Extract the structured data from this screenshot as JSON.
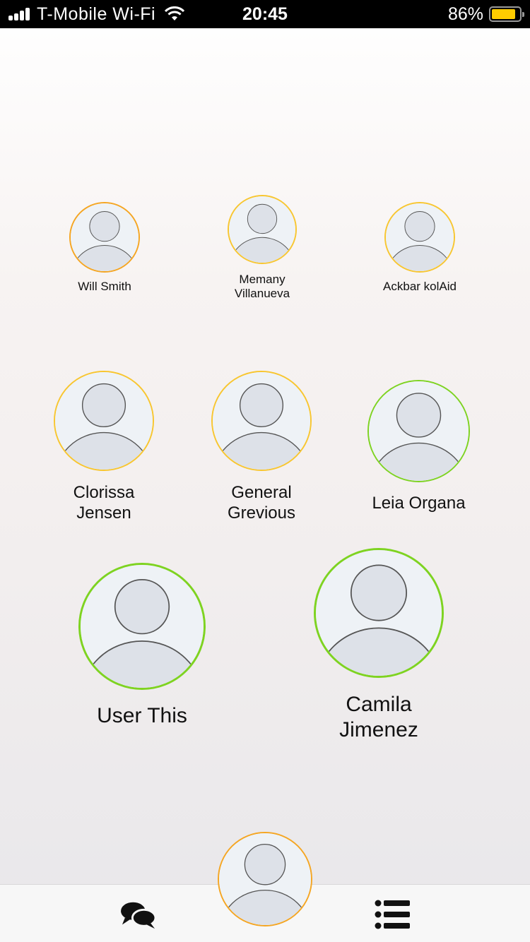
{
  "status_bar": {
    "carrier": "T-Mobile Wi-Fi",
    "time": "20:45",
    "battery_percent": "86%",
    "battery_level": 0.86,
    "battery_color": "#ffcc00",
    "signal_bars": 4,
    "signal_total": 4
  },
  "contacts": [
    {
      "name_line1": "Will Smith",
      "name_line2": "",
      "ring_color": "#f5a623"
    },
    {
      "name_line1": "Memany",
      "name_line2": "Villanueva",
      "ring_color": "#f8c630"
    },
    {
      "name_line1": "Ackbar kolAid",
      "name_line2": "",
      "ring_color": "#f8c630"
    },
    {
      "name_line1": "Clorissa",
      "name_line2": "Jensen",
      "ring_color": "#f8c630"
    },
    {
      "name_line1": "General",
      "name_line2": "Grevious",
      "ring_color": "#f8c630"
    },
    {
      "name_line1": "Leia Organa",
      "name_line2": "",
      "ring_color": "#7ed321"
    },
    {
      "name_line1": "User This",
      "name_line2": "",
      "ring_color": "#7ed321"
    },
    {
      "name_line1": "Camila",
      "name_line2": "Jimenez",
      "ring_color": "#7ed321"
    }
  ],
  "tab_bar": {
    "left_icon": "chat-bubbles-icon",
    "center_icon": "profile-avatar",
    "center_ring_color": "#f5a623",
    "right_icon": "list-icon"
  }
}
